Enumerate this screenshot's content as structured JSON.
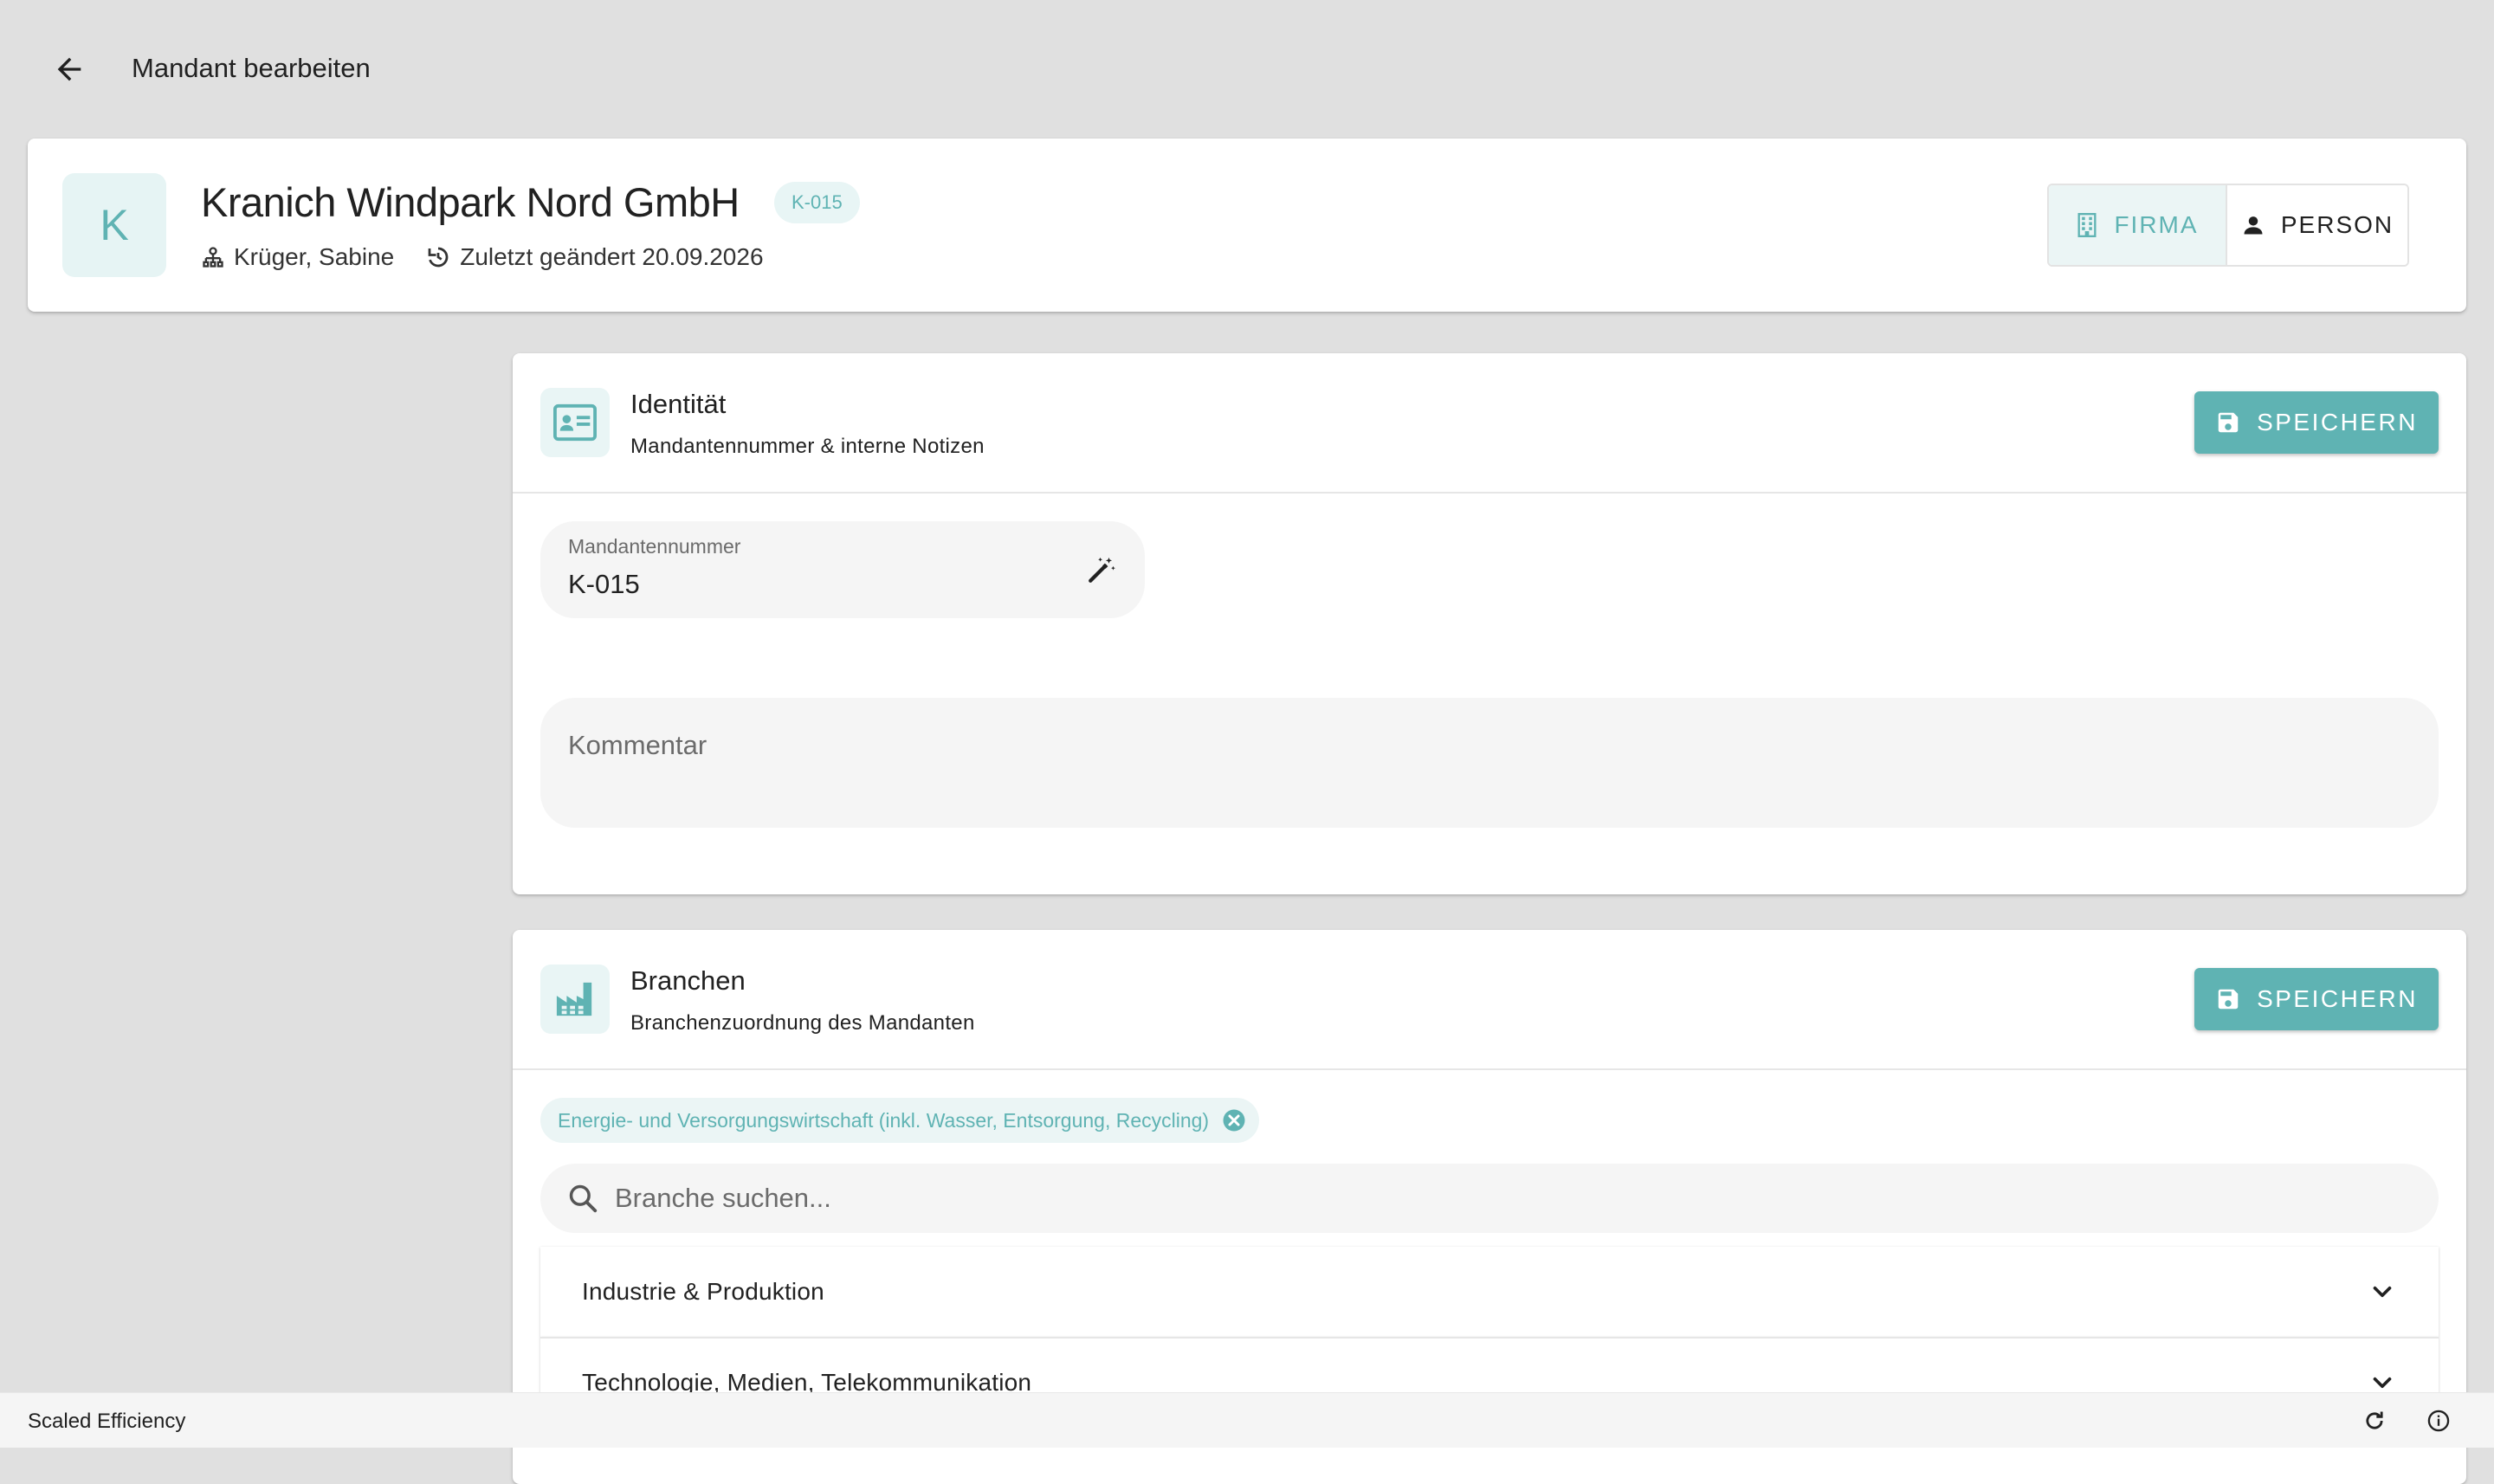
{
  "topbar": {
    "title": "Mandant bearbeiten"
  },
  "header": {
    "avatar_letter": "K",
    "company_name": "Kranich Windpark Nord GmbH",
    "code": "K-015",
    "owner": "Krüger, Sabine",
    "last_changed": "Zuletzt geändert 20.09.2026",
    "type_toggle": {
      "firma_label": "FIRMA",
      "person_label": "PERSON",
      "selected": "FIRMA"
    }
  },
  "identitaet": {
    "title": "Identität",
    "subtitle": "Mandantennummer & interne Notizen",
    "save_label": "SPEICHERN",
    "number_label": "Mandantennummer",
    "number_value": "K-015",
    "comment_placeholder": "Kommentar"
  },
  "branchen": {
    "title": "Branchen",
    "subtitle": "Branchenzuordnung des Mandanten",
    "save_label": "SPEICHERN",
    "selected_chip": "Energie- und Versorgungswirtschaft (inkl. Wasser, Entsorgung, Recycling)",
    "search_placeholder": "Branche suchen...",
    "groups": [
      {
        "label": "Industrie & Produktion"
      },
      {
        "label": "Technologie, Medien, Telekommunikation"
      }
    ]
  },
  "footer": {
    "brand": "Scaled Efficiency"
  },
  "colors": {
    "accent": "#5fb3b3",
    "accent_light": "#e8f5f5",
    "background": "#e0e0e0",
    "field": "#f5f5f5"
  }
}
